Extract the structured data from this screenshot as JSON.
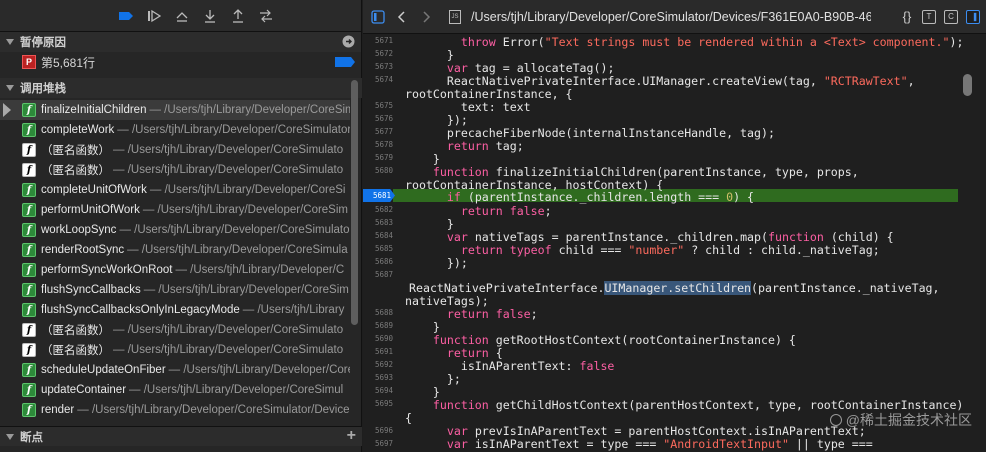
{
  "left": {
    "pause_section_title": "暂停原因",
    "pause_reason_badge": "P",
    "pause_reason": "第5,681行",
    "stack_section_title": "调用堆栈",
    "breakpoints_section_title": "断点",
    "frames": [
      {
        "fn": "finalizeInitialChildren",
        "path": "— /Users/tjh/Library/Developer/CoreSim",
        "badge": "green"
      },
      {
        "fn": "completeWork",
        "path": "— /Users/tjh/Library/Developer/CoreSimulator/",
        "badge": "green"
      },
      {
        "fn": "（匿名函数）",
        "path": "— /Users/tjh/Library/Developer/CoreSimulato",
        "badge": "white"
      },
      {
        "fn": "（匿名函数）",
        "path": "— /Users/tjh/Library/Developer/CoreSimulato",
        "badge": "white"
      },
      {
        "fn": "completeUnitOfWork",
        "path": "— /Users/tjh/Library/Developer/CoreSi",
        "badge": "green"
      },
      {
        "fn": "performUnitOfWork",
        "path": "— /Users/tjh/Library/Developer/CoreSim",
        "badge": "green"
      },
      {
        "fn": "workLoopSync",
        "path": "— /Users/tjh/Library/Developer/CoreSimulator",
        "badge": "green"
      },
      {
        "fn": "renderRootSync",
        "path": "— /Users/tjh/Library/Developer/CoreSimula",
        "badge": "green"
      },
      {
        "fn": "performSyncWorkOnRoot",
        "path": "— /Users/tjh/Library/Developer/C",
        "badge": "green"
      },
      {
        "fn": "flushSyncCallbacks",
        "path": "— /Users/tjh/Library/Developer/CoreSim",
        "badge": "green"
      },
      {
        "fn": "flushSyncCallbacksOnlyInLegacyMode",
        "path": "— /Users/tjh/Library",
        "badge": "green"
      },
      {
        "fn": "（匿名函数）",
        "path": "— /Users/tjh/Library/Developer/CoreSimulato",
        "badge": "white"
      },
      {
        "fn": "（匿名函数）",
        "path": "— /Users/tjh/Library/Developer/CoreSimulato",
        "badge": "white"
      },
      {
        "fn": "scheduleUpdateOnFiber",
        "path": "— /Users/tjh/Library/Developer/Core",
        "badge": "green"
      },
      {
        "fn": "updateContainer",
        "path": "— /Users/tjh/Library/Developer/CoreSimul",
        "badge": "green"
      },
      {
        "fn": "render",
        "path": "— /Users/tjh/Library/Developer/CoreSimulator/Device",
        "badge": "green"
      }
    ]
  },
  "right": {
    "file_path": "/Users/tjh/Library/Developer/CoreSimulator/Devices/F361E0A0-B90B-46...",
    "current_line": "5681",
    "watermark": "@稀土掘金技术社区"
  },
  "colors": {
    "current_line_bg": "#2f6b1f",
    "keyword": "#fc5fa3",
    "string": "#fc6a5d",
    "number": "#d0bf69",
    "breakpoint_blue": "#1173e8"
  }
}
